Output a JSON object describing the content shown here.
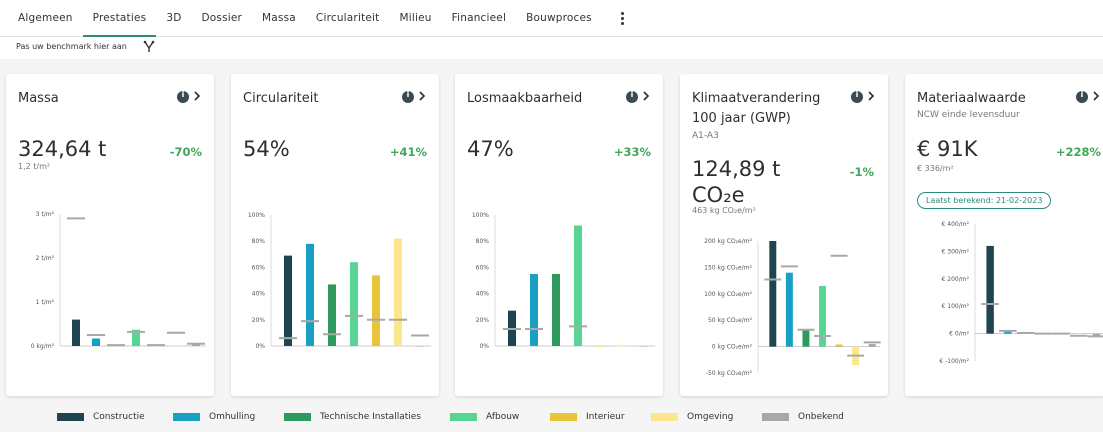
{
  "tabs": [
    {
      "label": "Algemeen"
    },
    {
      "label": "Prestaties"
    },
    {
      "label": "3D"
    },
    {
      "label": "Dossier"
    },
    {
      "label": "Massa"
    },
    {
      "label": "Circulariteit"
    },
    {
      "label": "Milieu"
    },
    {
      "label": "Financieel"
    },
    {
      "label": "Bouwproces"
    }
  ],
  "active_tab": "Prestaties",
  "benchmark": {
    "label": "Pas uw benchmark hier aan"
  },
  "colors": {
    "accent": "#2f8a7e",
    "positive": "#3fa65a",
    "Constructie": "#1f4650",
    "Omhulling": "#1aa0c4",
    "Technische Installaties": "#2e9a5e",
    "Afbouw": "#5ad495",
    "Interieur": "#e8c43a",
    "Omgeving": "#fce58c",
    "Onbekend": "#a8a8a8"
  },
  "legend": [
    "Constructie",
    "Omhulling",
    "Technische Installaties",
    "Afbouw",
    "Interieur",
    "Omgeving",
    "Onbekend"
  ],
  "cards": [
    {
      "title": "Massa",
      "value": "324,64 t",
      "delta": "-70%",
      "unit": "1,2 t/m²"
    },
    {
      "title": "Circulariteit",
      "value": "54%",
      "delta": "+41%"
    },
    {
      "title": "Losmaakbaarheid",
      "value": "47%",
      "delta": "+33%"
    },
    {
      "title": "Klimaatverandering 100 jaar (GWP)",
      "subtitle": "A1-A3",
      "value": "124,89 t CO₂e",
      "delta": "-1%",
      "unit": "463 kg CO₂e/m²"
    },
    {
      "title": "Materiaalwaarde",
      "subtitle": "NCW einde levensduur",
      "value": "€ 91K",
      "delta": "+228%",
      "unit": "€ 336/m²",
      "badge": "Laatst berekend: 21-02-2023"
    }
  ],
  "chart_data": [
    {
      "type": "bar",
      "title": "Massa",
      "ylim": [
        0,
        3
      ],
      "yticks": [
        "0 kg/m²",
        "1 t/m²",
        "2 t/m²",
        "3 t/m²"
      ],
      "ytick_values": [
        0,
        1,
        2,
        3
      ],
      "categories": [
        "Constructie",
        "Omhulling",
        "Technische Installaties",
        "Afbouw",
        "Interieur",
        "Omgeving",
        "Onbekend"
      ],
      "values": [
        0.6,
        0.17,
        0.01,
        0.37,
        0.02,
        0.01,
        0.04
      ],
      "benchmarks": [
        2.9,
        0.25,
        0.02,
        0.32,
        0.02,
        0.3,
        0.05
      ]
    },
    {
      "type": "bar",
      "title": "Circulariteit",
      "ylim": [
        0,
        100
      ],
      "yticks": [
        "0%",
        "20%",
        "40%",
        "60%",
        "80%",
        "100%"
      ],
      "ytick_values": [
        0,
        20,
        40,
        60,
        80,
        100
      ],
      "categories": [
        "Constructie",
        "Omhulling",
        "Technische Installaties",
        "Afbouw",
        "Interieur",
        "Omgeving",
        "Onbekend"
      ],
      "values": [
        69,
        78,
        47,
        64,
        54,
        82,
        0
      ],
      "benchmarks": [
        6,
        19,
        9,
        23,
        20,
        20,
        8
      ]
    },
    {
      "type": "bar",
      "title": "Losmaakbaarheid",
      "ylim": [
        0,
        100
      ],
      "yticks": [
        "0%",
        "20%",
        "40%",
        "60%",
        "80%",
        "100%"
      ],
      "ytick_values": [
        0,
        20,
        40,
        60,
        80,
        100
      ],
      "categories": [
        "Constructie",
        "Omhulling",
        "Technische Installaties",
        "Afbouw",
        "Interieur",
        "Omgeving",
        "Onbekend"
      ],
      "values": [
        27,
        55,
        55,
        92,
        0,
        0,
        0
      ],
      "benchmarks": [
        13,
        13,
        null,
        15,
        null,
        null,
        null
      ]
    },
    {
      "type": "bar",
      "title": "Klimaatverandering 100 jaar (GWP)",
      "ylim": [
        -50,
        200
      ],
      "yticks": [
        "-50 kg CO₂e/m²",
        "0 kg CO₂e/m²",
        "50 kg CO₂e/m²",
        "100 kg CO₂e/m²",
        "150 kg CO₂e/m²",
        "200 kg CO₂e/m²"
      ],
      "ytick_values": [
        -50,
        0,
        50,
        100,
        150,
        200
      ],
      "categories": [
        "Constructie",
        "Omhulling",
        "Technische Installaties",
        "Afbouw",
        "Interieur",
        "Omgeving",
        "Onbekend"
      ],
      "values": [
        200,
        140,
        32,
        115,
        4,
        -35,
        5
      ],
      "benchmarks": [
        127,
        152,
        32,
        20,
        172,
        -17,
        8
      ]
    },
    {
      "type": "bar",
      "title": "Materiaalwaarde",
      "ylim": [
        -100,
        400
      ],
      "yticks": [
        "€ -100/m²",
        "€ 0/m²",
        "€ 100/m²",
        "€ 200/m²",
        "€ 300/m²",
        "€ 400/m²"
      ],
      "ytick_values": [
        -100,
        0,
        100,
        200,
        300,
        400
      ],
      "categories": [
        "Constructie",
        "Omhulling",
        "Technische Installaties",
        "Afbouw",
        "Interieur",
        "Omgeving",
        "Onbekend"
      ],
      "values": [
        320,
        10,
        6,
        2,
        2,
        1,
        -10
      ],
      "benchmarks": [
        108,
        10,
        2,
        0,
        0,
        -8,
        -10
      ]
    }
  ]
}
